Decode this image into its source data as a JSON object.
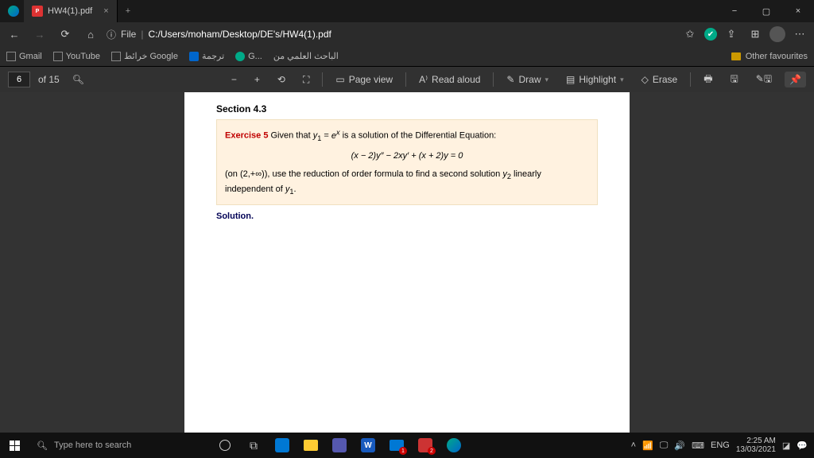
{
  "tab": {
    "title": "HW4(1).pdf"
  },
  "url": {
    "scheme": "File",
    "path": "C:/Users/moham/Desktop/DE's/HW4(1).pdf"
  },
  "favorites": {
    "items": [
      "Gmail",
      "YouTube",
      "خرائط Google",
      "ترجمة",
      "G...",
      "الباحث العلمي من"
    ],
    "other": "Other favourites"
  },
  "pdftool": {
    "page": "6",
    "of": "of 15",
    "pageview": "Page view",
    "readaloud": "Read aloud",
    "draw": "Draw",
    "highlight": "Highlight",
    "erase": "Erase"
  },
  "doc": {
    "section": "Section 4.3",
    "ex_label": "Exercise 5",
    "ex_line1a": "Given that ",
    "ex_line1b": " is a solution of the Differential Equation:",
    "eq": "(x − 2)y″ − 2xy′ + (x + 2)y = 0",
    "ex_line2a": "(on (2,+∞)), use the reduction of order formula to find a second solution ",
    "ex_line2b": " linearly independent of ",
    "solution": "Solution."
  },
  "taskbar": {
    "search_placeholder": "Type here to search",
    "lang": "ENG",
    "time": "2:25 AM",
    "date": "13/03/2021"
  }
}
